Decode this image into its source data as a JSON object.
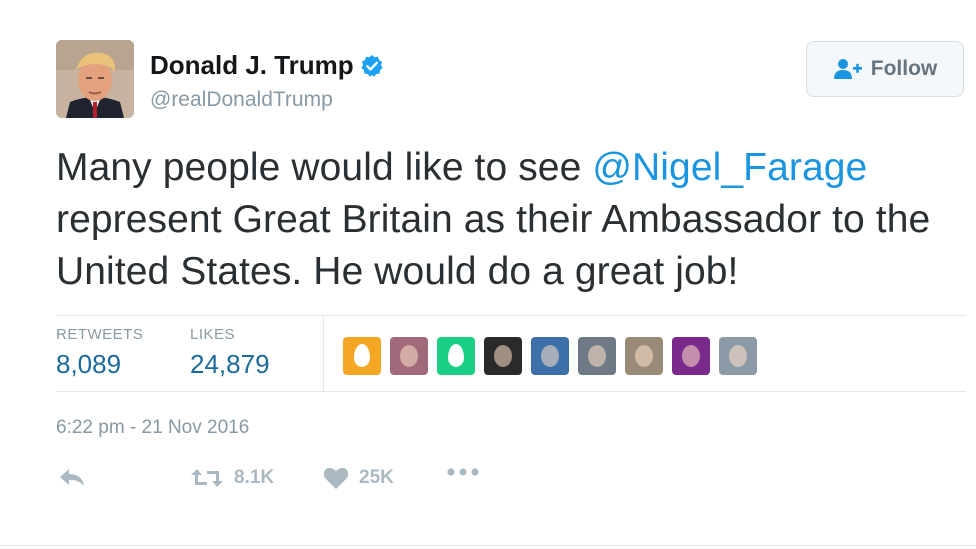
{
  "author": {
    "display_name": "Donald J. Trump",
    "screen_name": "@realDonaldTrump",
    "verified": true,
    "avatar": "profile-photo"
  },
  "follow_button": {
    "label": "Follow",
    "icon": "follow-person-plus-icon"
  },
  "tweet": {
    "text_before": "Many people would like to see ",
    "mention": "@Nigel_Farage",
    "text_after": " represent Great Britain as their Ambassador to the United States. He would do a great job!"
  },
  "stats": {
    "retweets_label": "RETWEETS",
    "retweets_value": "8,089",
    "likes_label": "LIKES",
    "likes_value": "24,879"
  },
  "likers": [
    {
      "kind": "default-egg",
      "color": "#f5a623"
    },
    {
      "kind": "photo",
      "color": "#a06a7a"
    },
    {
      "kind": "default-egg",
      "color": "#19cf86"
    },
    {
      "kind": "photo",
      "color": "#2a2a2a"
    },
    {
      "kind": "photo",
      "color": "#3d6fa8"
    },
    {
      "kind": "photo",
      "color": "#6f7a86"
    },
    {
      "kind": "photo",
      "color": "#9a8a78"
    },
    {
      "kind": "photo",
      "color": "#7a2a8c"
    },
    {
      "kind": "photo",
      "color": "#8c9aa8"
    }
  ],
  "timestamp": "6:22 pm - 21 Nov 2016",
  "actions": {
    "reply_icon": "reply-icon",
    "retweet_icon": "retweet-icon",
    "retweet_count": "8.1K",
    "like_icon": "heart-icon",
    "like_count": "25K",
    "more_icon": "more-icon"
  },
  "colors": {
    "link": "#1b95e0",
    "verified": "#1da1f2",
    "muted": "#8899a6",
    "stat_value": "#1b6a9c"
  }
}
